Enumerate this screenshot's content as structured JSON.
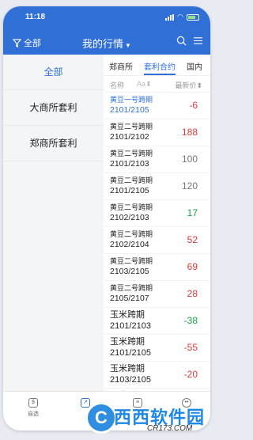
{
  "status": {
    "time": "11:18"
  },
  "nav": {
    "filter_label": "全部",
    "title": "我的行情"
  },
  "left_menu": [
    {
      "label": "全部"
    },
    {
      "label": "大商所套利"
    },
    {
      "label": "郑商所套利"
    }
  ],
  "tabs": [
    {
      "label": "郑商所"
    },
    {
      "label": "套利合约"
    },
    {
      "label": "国内"
    }
  ],
  "columns": {
    "name": "名称",
    "sort": "Aa",
    "price": "最新价"
  },
  "rows": [
    {
      "name": "黄豆一号跨期",
      "code": "2101/2105",
      "price": "-6"
    },
    {
      "name": "黄豆二号跨期",
      "code": "2101/2102",
      "price": "188"
    },
    {
      "name": "黄豆二号跨期",
      "code": "2101/2103",
      "price": "100"
    },
    {
      "name": "黄豆二号跨期",
      "code": "2101/2105",
      "price": "120"
    },
    {
      "name": "黄豆二号跨期",
      "code": "2102/2103",
      "price": "17"
    },
    {
      "name": "黄豆二号跨期",
      "code": "2102/2104",
      "price": "52"
    },
    {
      "name": "黄豆二号跨期",
      "code": "2103/2105",
      "price": "69"
    },
    {
      "name": "黄豆二号跨期",
      "code": "2105/2107",
      "price": "28"
    },
    {
      "name": "玉米跨期",
      "code": "2101/2103",
      "price": "-38"
    },
    {
      "name": "玉米跨期",
      "code": "2101/2105",
      "price": "-55"
    },
    {
      "name": "玉米跨期",
      "code": "2103/2105",
      "price": "-20"
    },
    {
      "name": "玉米跨期",
      "code": "",
      "price": ""
    }
  ],
  "tabbar": {
    "first_label": "自选"
  },
  "watermark": {
    "text": "西西软件园",
    "url": "CR173.COM"
  },
  "colors": {
    "accent": "#2f6fd6",
    "up": "#e03a3a",
    "down": "#1aa34a",
    "flat": "#777777"
  }
}
